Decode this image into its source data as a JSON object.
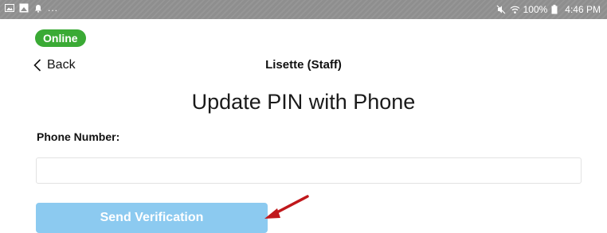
{
  "status_bar": {
    "left_dots": "...",
    "battery_text": "100%",
    "time": "4:46 PM",
    "icons": [
      "gallery-icon",
      "image-icon",
      "notification-icon",
      "mute-icon",
      "wifi-icon",
      "battery-icon"
    ]
  },
  "connection_badge": {
    "label": "Online",
    "color": "#3aaa35"
  },
  "nav": {
    "back_label": "Back",
    "title": "Lisette (Staff)"
  },
  "page_title": "Update PIN with Phone",
  "form": {
    "phone_label": "Phone Number:",
    "phone_value": "",
    "phone_placeholder": "",
    "send_label": "Send Verification",
    "send_button_color": "#8ccaf0"
  },
  "annotation": {
    "arrow_color": "#c0171b"
  }
}
